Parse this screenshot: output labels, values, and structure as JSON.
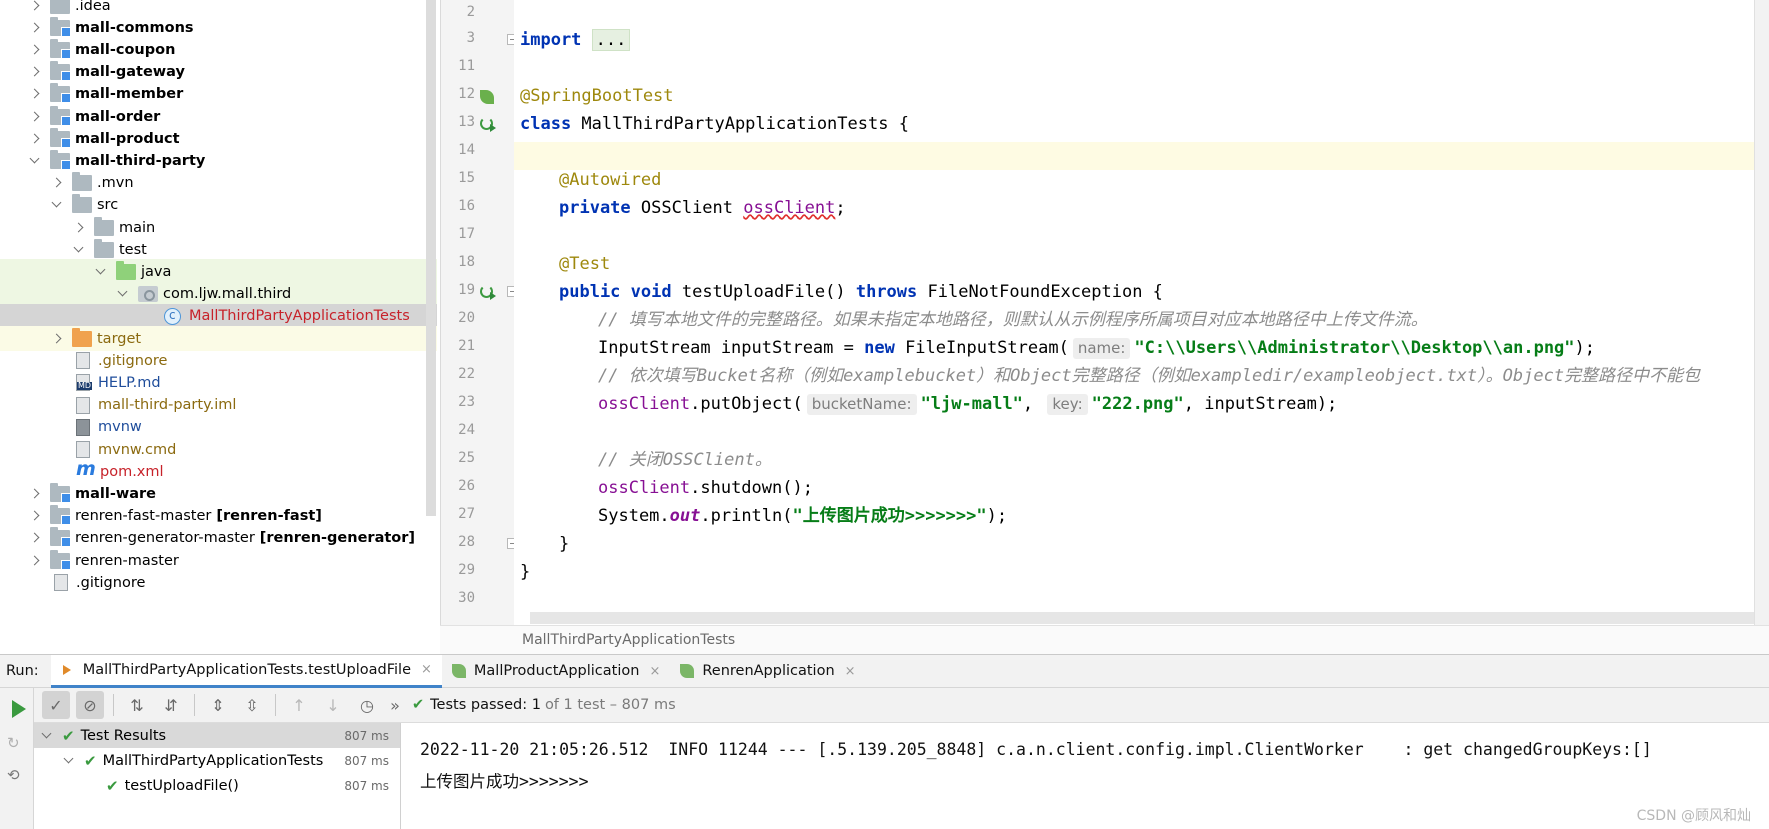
{
  "project_tree": [
    {
      "label": ".idea",
      "bold": false,
      "icon": "folder",
      "arrow": "right",
      "depth": 1,
      "style": ""
    },
    {
      "label": "mall-commons",
      "bold": true,
      "icon": "module-folder",
      "arrow": "right",
      "depth": 1,
      "style": ""
    },
    {
      "label": "mall-coupon",
      "bold": true,
      "icon": "module-folder",
      "arrow": "right",
      "depth": 1,
      "style": ""
    },
    {
      "label": "mall-gateway",
      "bold": true,
      "icon": "module-folder",
      "arrow": "right",
      "depth": 1,
      "style": ""
    },
    {
      "label": "mall-member",
      "bold": true,
      "icon": "module-folder",
      "arrow": "right",
      "depth": 1,
      "style": ""
    },
    {
      "label": "mall-order",
      "bold": true,
      "icon": "module-folder",
      "arrow": "right",
      "depth": 1,
      "style": ""
    },
    {
      "label": "mall-product",
      "bold": true,
      "icon": "module-folder",
      "arrow": "right",
      "depth": 1,
      "style": ""
    },
    {
      "label": "mall-third-party",
      "bold": true,
      "icon": "module-folder",
      "arrow": "down",
      "depth": 1,
      "style": ""
    },
    {
      "label": ".mvn",
      "bold": false,
      "icon": "folder",
      "arrow": "right",
      "depth": 2,
      "style": ""
    },
    {
      "label": "src",
      "bold": false,
      "icon": "folder",
      "arrow": "down",
      "depth": 2,
      "style": ""
    },
    {
      "label": "main",
      "bold": false,
      "icon": "folder",
      "arrow": "right",
      "depth": 3,
      "style": ""
    },
    {
      "label": "test",
      "bold": false,
      "icon": "folder",
      "arrow": "down",
      "depth": 3,
      "style": ""
    },
    {
      "label": "java",
      "bold": false,
      "icon": "test-folder",
      "arrow": "down",
      "depth": 4,
      "style": "green"
    },
    {
      "label": "com.ljw.mall.third",
      "bold": false,
      "icon": "package",
      "arrow": "down",
      "depth": 5,
      "style": "green"
    },
    {
      "label": "MallThirdPartyApplicationTests",
      "bold": false,
      "icon": "class-file",
      "arrow": "none",
      "depth": 6,
      "style": "selected"
    },
    {
      "label": "target",
      "bold": false,
      "icon": "excluded-folder",
      "arrow": "right",
      "depth": 2,
      "style": "yellow"
    },
    {
      "label": ".gitignore",
      "bold": false,
      "icon": "gitignore-file",
      "arrow": "none",
      "depth": 2,
      "style": ""
    },
    {
      "label": "HELP.md",
      "bold": false,
      "icon": "markdown-file",
      "arrow": "none",
      "depth": 2,
      "style": ""
    },
    {
      "label": "mall-third-party.iml",
      "bold": false,
      "icon": "iml-file",
      "arrow": "none",
      "depth": 2,
      "style": ""
    },
    {
      "label": "mvnw",
      "bold": false,
      "icon": "script-file",
      "arrow": "none",
      "depth": 2,
      "style": ""
    },
    {
      "label": "mvnw.cmd",
      "bold": false,
      "icon": "text-file",
      "arrow": "none",
      "depth": 2,
      "style": ""
    },
    {
      "label": "pom.xml",
      "bold": false,
      "icon": "maven-file",
      "arrow": "none",
      "depth": 2,
      "style": ""
    },
    {
      "label": "mall-ware",
      "bold": true,
      "icon": "module-folder",
      "arrow": "right",
      "depth": 1,
      "style": ""
    },
    {
      "label": "renren-fast-master",
      "suffix": "[renren-fast]",
      "bold": false,
      "icon": "module-folder",
      "arrow": "right",
      "depth": 1,
      "style": ""
    },
    {
      "label": "renren-generator-master",
      "suffix": "[renren-generator]",
      "bold": false,
      "icon": "module-folder",
      "arrow": "right",
      "depth": 1,
      "style": ""
    },
    {
      "label": "renren-master",
      "bold": false,
      "icon": "module-folder",
      "arrow": "right",
      "depth": 1,
      "style": ""
    },
    {
      "label": ".gitignore",
      "bold": false,
      "icon": "gitignore-file",
      "arrow": "none",
      "depth": 1,
      "style": ""
    }
  ],
  "editor": {
    "line_numbers": [
      "2",
      "3",
      "11",
      "12",
      "13",
      "14",
      "15",
      "16",
      "17",
      "18",
      "19",
      "20",
      "21",
      "22",
      "23",
      "24",
      "25",
      "26",
      "27",
      "28",
      "29",
      "30"
    ],
    "code": {
      "l3_kw": "import",
      "l3_folded": "...",
      "l12_ann": "@SpringBootTest",
      "l13_kw": "class",
      "l13_rest": " MallThirdPartyApplicationTests {",
      "l15_ann": "@Autowired",
      "l16_kw": "private",
      "l16_type": " OSSClient ",
      "l16_field": "ossClient",
      "l16_end": ";",
      "l18_ann": "@Test",
      "l19_kw1": "public",
      "l19_kw2": " void",
      "l19_mid": " testUploadFile() ",
      "l19_kw3": "throws",
      "l19_end": " FileNotFoundException {",
      "l20_cmt": "// 填写本地文件的完整路径。如果未指定本地路径，则默认从示例程序所属项目对应本地路径中上传文件流。",
      "l21_a": "InputStream inputStream = ",
      "l21_kw": "new",
      "l21_b": " FileInputStream(",
      "l21_hint": "name:",
      "l21_str": "\"C:\\\\Users\\\\Administrator\\\\Desktop\\\\an.png\"",
      "l21_end": ");",
      "l22_cmt": "// 依次填写Bucket名称（例如examplebucket）和Object完整路径（例如exampledir/exampleobject.txt）。Object完整路径中不能包",
      "l23_field": "ossClient",
      "l23_a": ".putObject(",
      "l23_hint1": "bucketName:",
      "l23_str1": "\"ljw-mall\"",
      "l23_comma": ", ",
      "l23_hint2": "key:",
      "l23_str2": "\"222.png\"",
      "l23_end": ", inputStream);",
      "l25_cmt": "// 关闭OSSClient。",
      "l26_field": "ossClient",
      "l26_end": ".shutdown();",
      "l27_a": "System.",
      "l27_out": "out",
      "l27_b": ".println(",
      "l27_str": "\"上传图片成功>>>>>>>\"",
      "l27_end": ");",
      "l28": "}",
      "l29": "}"
    },
    "breadcrumb": "MallThirdPartyApplicationTests"
  },
  "run_panel": {
    "label": "Run:",
    "tabs": [
      {
        "label": "MallThirdPartyApplicationTests.testUploadFile",
        "close": "×"
      },
      {
        "label": "MallProductApplication",
        "close": "×"
      },
      {
        "label": "RenrenApplication",
        "close": "×"
      }
    ],
    "status_check": "✔",
    "status_prefix": "Tests passed:",
    "status_count": "1",
    "status_rest": "of 1 test – 807 ms",
    "overflow": "»"
  },
  "test_tree": [
    {
      "label": "Test Results",
      "duration": "807 ms"
    },
    {
      "label": "MallThirdPartyApplicationTests",
      "duration": "807 ms"
    },
    {
      "label": "testUploadFile()",
      "duration": "807 ms"
    }
  ],
  "console": {
    "line1": "2022-11-20 21:05:26.512  INFO 11244 --- [.5.139.205_8848] c.a.n.client.config.impl.ClientWorker    : get changedGroupKeys:[]",
    "line2": "上传图片成功>>>>>>>"
  },
  "watermark": "CSDN @顾风和灿"
}
